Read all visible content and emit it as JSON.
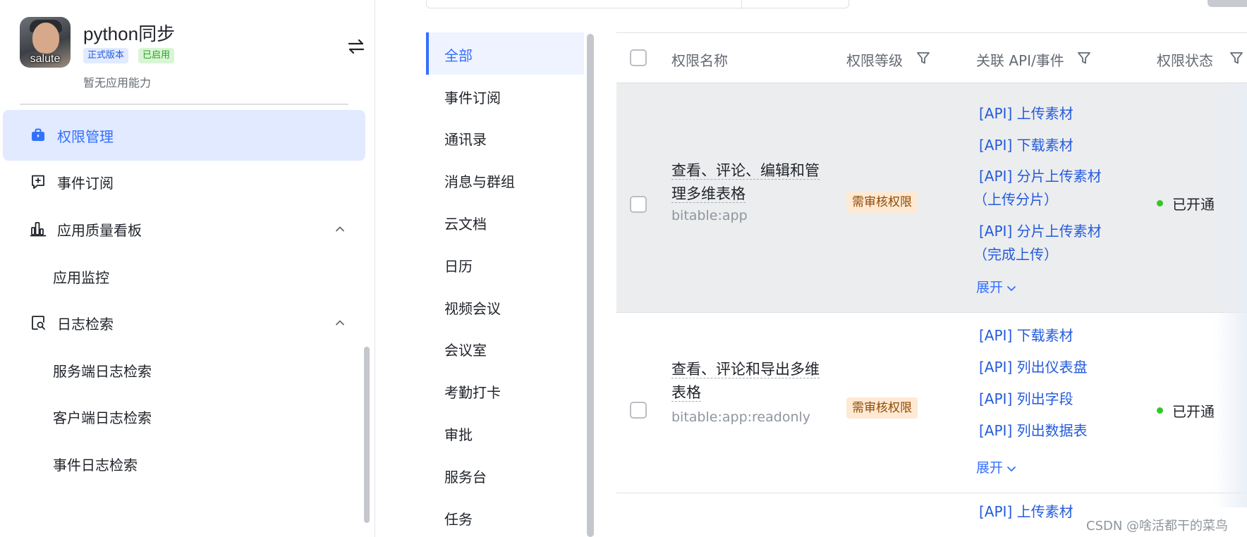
{
  "app": {
    "name": "python同步",
    "version_tag": "正式版本",
    "status_tag": "已启用",
    "description": "暂无应用能力",
    "avatar_text": "salute"
  },
  "nav": [
    {
      "label": "权限管理",
      "icon": "briefcase-icon",
      "active": true
    },
    {
      "label": "事件订阅",
      "icon": "event-add-icon",
      "active": false
    },
    {
      "label": "应用质量看板",
      "icon": "bar-chart-icon",
      "active": false,
      "expanded": true
    },
    {
      "label": "应用监控",
      "sub": true
    },
    {
      "label": "日志检索",
      "icon": "log-search-icon",
      "active": false,
      "expanded": true
    },
    {
      "label": "服务端日志检索",
      "sub": true
    },
    {
      "label": "客户端日志检索",
      "sub": true
    },
    {
      "label": "事件日志检索",
      "sub": true
    }
  ],
  "categories": [
    "全部",
    "事件订阅",
    "通讯录",
    "消息与群组",
    "云文档",
    "日历",
    "视频会议",
    "会议室",
    "考勤打卡",
    "审批",
    "服务台",
    "任务"
  ],
  "table": {
    "headers": {
      "name": "权限名称",
      "level": "权限等级",
      "api": "关联 API/事件",
      "status": "权限状态"
    },
    "rows": [
      {
        "name_lines": [
          "查看、评论、编辑和管",
          "理多维表格"
        ],
        "scope": "bitable:app",
        "level": "需审核权限",
        "apis": [
          "[API] 上传素材",
          "[API] 下载素材",
          "[API] 分片上传素材",
          "（上传分片）",
          "[API] 分片上传素材",
          "（完成上传）"
        ],
        "expand": "展开",
        "status": "已开通"
      },
      {
        "name_lines": [
          "查看、评论和导出多维",
          "表格"
        ],
        "scope": "bitable:app:readonly",
        "level": "需审核权限",
        "apis": [
          "[API] 下载素材",
          "[API] 列出仪表盘",
          "[API] 列出字段",
          "[API] 列出数据表"
        ],
        "expand": "展开",
        "status": "已开通"
      },
      {
        "apis": [
          "[API] 上传素材"
        ]
      }
    ]
  },
  "watermark": "CSDN @啥活都干的菜鸟",
  "colors": {
    "accent": "#3370ff",
    "link": "#245bdb",
    "status_green": "#34c724",
    "tag_bg": "#fee9d4",
    "active_bg": "#e1eaff"
  }
}
